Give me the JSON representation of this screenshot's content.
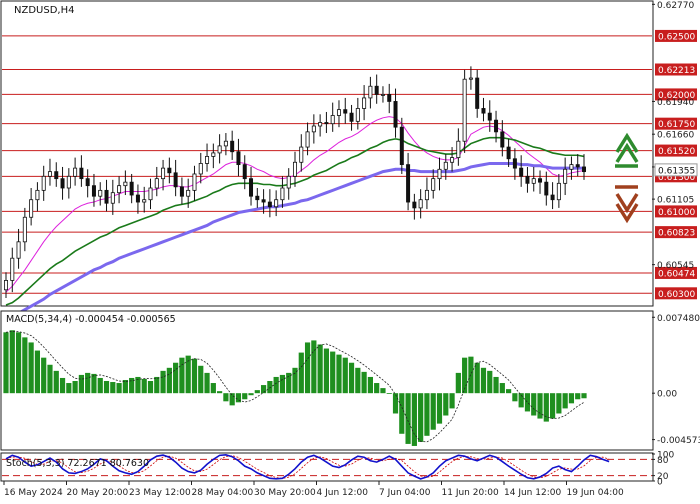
{
  "chart_data": [
    {
      "type": "candlestick",
      "title": "NZDUSD,H4",
      "ylim": [
        0.602,
        0.6279
      ],
      "price_tick_labels": [
        {
          "value": 0.6277,
          "label": "0.62770"
        },
        {
          "value": 0.6194,
          "label": "0.61940"
        },
        {
          "value": 0.6166,
          "label": "0.61660"
        },
        {
          "value": 0.6138,
          "label": "0.61380"
        },
        {
          "value": 0.61105,
          "label": "0.61105"
        },
        {
          "value": 0.60545,
          "label": "0.60545"
        }
      ],
      "levels": [
        {
          "value": 0.625,
          "label": "0.62500"
        },
        {
          "value": 0.62213,
          "label": "0.62213"
        },
        {
          "value": 0.62,
          "label": "0.62000"
        },
        {
          "value": 0.6175,
          "label": "0.61750"
        },
        {
          "value": 0.6152,
          "label": "0.61520"
        },
        {
          "value": 0.613,
          "label": "0.61300"
        },
        {
          "value": 0.61,
          "label": "0.61000"
        },
        {
          "value": 0.60823,
          "label": "0.60823"
        },
        {
          "value": 0.60474,
          "label": "0.60474"
        },
        {
          "value": 0.603,
          "label": "0.60300"
        }
      ],
      "current_price": {
        "value": 0.61355,
        "label": "0.61355"
      },
      "trend_signals": [
        "up-arrow",
        "down-arrow"
      ],
      "close_series": [
        0.6041,
        0.606,
        0.6074,
        0.6095,
        0.611,
        0.6118,
        0.613,
        0.6134,
        0.6128,
        0.612,
        0.613,
        0.6137,
        0.6128,
        0.6122,
        0.6113,
        0.6118,
        0.6107,
        0.6116,
        0.6122,
        0.6125,
        0.6114,
        0.6108,
        0.611,
        0.612,
        0.6128,
        0.6137,
        0.6133,
        0.6121,
        0.6113,
        0.6118,
        0.6132,
        0.6141,
        0.6147,
        0.615,
        0.6156,
        0.616,
        0.6151,
        0.614,
        0.6128,
        0.6113,
        0.611,
        0.6108,
        0.6104,
        0.611,
        0.612,
        0.613,
        0.6142,
        0.6155,
        0.6168,
        0.6173,
        0.6176,
        0.6175,
        0.6182,
        0.6187,
        0.6184,
        0.6177,
        0.6188,
        0.6197,
        0.6207,
        0.62,
        0.62,
        0.6194,
        0.6172,
        0.614,
        0.6108,
        0.6103,
        0.611,
        0.6118,
        0.6128,
        0.6136,
        0.6142,
        0.6146,
        0.616,
        0.6213,
        0.6214,
        0.6188,
        0.6184,
        0.6178,
        0.6168,
        0.6155,
        0.6145,
        0.6137,
        0.613,
        0.6124,
        0.6128,
        0.6125,
        0.6114,
        0.611,
        0.6124,
        0.6136,
        0.614,
        0.6138,
        0.6134
      ],
      "moving_averages": [
        {
          "color": "#dd22dd",
          "values": [
            0.6031,
            0.6036,
            0.6043,
            0.605,
            0.6058,
            0.6066,
            0.6074,
            0.6081,
            0.6087,
            0.6092,
            0.6097,
            0.6102,
            0.6105,
            0.6107,
            0.6108,
            0.611,
            0.6111,
            0.6113,
            0.6115,
            0.6117,
            0.6117,
            0.6117,
            0.6117,
            0.6118,
            0.6119,
            0.6121,
            0.6122,
            0.6122,
            0.6121,
            0.6121,
            0.6123,
            0.6126,
            0.6129,
            0.6132,
            0.6136,
            0.614,
            0.6142,
            0.6142,
            0.6141,
            0.6139,
            0.6136,
            0.6134,
            0.6131,
            0.6129,
            0.6128,
            0.6129,
            0.6131,
            0.6135,
            0.6139,
            0.6144,
            0.6148,
            0.6151,
            0.6155,
            0.6159,
            0.6162,
            0.6164,
            0.6167,
            0.6171,
            0.6175,
            0.6178,
            0.618,
            0.6181,
            0.618,
            0.6175,
            0.6167,
            0.616,
            0.6154,
            0.615,
            0.6147,
            0.6145,
            0.6144,
            0.6144,
            0.6146,
            0.6156,
            0.6166,
            0.6169,
            0.6172,
            0.6173,
            0.6172,
            0.6169,
            0.6165,
            0.616,
            0.6155,
            0.615,
            0.6146,
            0.6142,
            0.6137,
            0.6132,
            0.613,
            0.6131,
            0.6133,
            0.6134,
            0.6135
          ]
        },
        {
          "color": "#1a7a1a",
          "values": [
            0.602,
            0.6022,
            0.6026,
            0.6031,
            0.6036,
            0.6041,
            0.6046,
            0.6051,
            0.6055,
            0.6058,
            0.6062,
            0.6066,
            0.6069,
            0.6072,
            0.6075,
            0.6078,
            0.608,
            0.6083,
            0.6086,
            0.6088,
            0.609,
            0.6092,
            0.6094,
            0.6096,
            0.6098,
            0.6101,
            0.6103,
            0.6105,
            0.6106,
            0.6107,
            0.6109,
            0.6111,
            0.6113,
            0.6116,
            0.6118,
            0.6121,
            0.6123,
            0.6124,
            0.6124,
            0.6124,
            0.6124,
            0.6123,
            0.6123,
            0.6122,
            0.6122,
            0.6123,
            0.6124,
            0.6126,
            0.6128,
            0.6131,
            0.6133,
            0.6135,
            0.6138,
            0.6141,
            0.6143,
            0.6146,
            0.6148,
            0.6151,
            0.6154,
            0.6156,
            0.6159,
            0.6161,
            0.6162,
            0.6161,
            0.6158,
            0.6156,
            0.6154,
            0.6152,
            0.6151,
            0.615,
            0.6149,
            0.6149,
            0.615,
            0.6154,
            0.6158,
            0.616,
            0.6162,
            0.6163,
            0.6163,
            0.6163,
            0.6162,
            0.6161,
            0.6159,
            0.6157,
            0.6155,
            0.6154,
            0.6152,
            0.615,
            0.6149,
            0.6148,
            0.6148,
            0.6148,
            0.6147
          ]
        },
        {
          "color": "#7b68ee",
          "values": [
            0.6008,
            0.601,
            0.6013,
            0.6016,
            0.6019,
            0.6022,
            0.6025,
            0.6029,
            0.6032,
            0.6035,
            0.6038,
            0.6041,
            0.6044,
            0.6047,
            0.605,
            0.6052,
            0.6055,
            0.6057,
            0.606,
            0.6062,
            0.6064,
            0.6066,
            0.6068,
            0.607,
            0.6072,
            0.6074,
            0.6076,
            0.6078,
            0.608,
            0.6082,
            0.6084,
            0.6086,
            0.6088,
            0.6091,
            0.6093,
            0.6095,
            0.6097,
            0.6099,
            0.61,
            0.6101,
            0.6102,
            0.6103,
            0.6104,
            0.6104,
            0.6105,
            0.6106,
            0.6107,
            0.6109,
            0.611,
            0.6112,
            0.6114,
            0.6116,
            0.6118,
            0.612,
            0.6122,
            0.6124,
            0.6126,
            0.6128,
            0.613,
            0.6132,
            0.6134,
            0.6135,
            0.6136,
            0.6136,
            0.6135,
            0.6135,
            0.6134,
            0.6134,
            0.6134,
            0.6134,
            0.6134,
            0.6134,
            0.6135,
            0.6136,
            0.6138,
            0.6139,
            0.614,
            0.6141,
            0.6141,
            0.6141,
            0.6141,
            0.6141,
            0.614,
            0.614,
            0.6139,
            0.6139,
            0.6138,
            0.6137,
            0.6137,
            0.6137,
            0.6137,
            0.6137,
            0.6137
          ]
        }
      ]
    },
    {
      "type": "bar",
      "title": "MACD(5,34,4) -0.000454 -0.000565",
      "ylim": [
        -0.0055,
        0.008
      ],
      "tick_labels": [
        {
          "value": 0.00748,
          "label": "0.007480"
        },
        {
          "value": 0,
          "label": "0.00"
        },
        {
          "value": -0.004573,
          "label": "-0.004573"
        }
      ],
      "bar_color": "#1f8f1f",
      "signal_color": "#222222",
      "histogram": [
        0.006,
        0.0062,
        0.006,
        0.0055,
        0.005,
        0.0042,
        0.0035,
        0.0028,
        0.0022,
        0.0015,
        0.001,
        0.0012,
        0.0018,
        0.002,
        0.0019,
        0.0015,
        0.0012,
        0.0011,
        0.001,
        0.0013,
        0.0015,
        0.0016,
        0.0014,
        0.0012,
        0.0016,
        0.0022,
        0.0025,
        0.003,
        0.0035,
        0.0037,
        0.0034,
        0.0027,
        0.002,
        0.001,
        0.0002,
        -0.0008,
        -0.0012,
        -0.0009,
        -0.0006,
        -0.0002,
        0.0003,
        0.0008,
        0.0012,
        0.0016,
        0.0018,
        0.002,
        0.0025,
        0.004,
        0.005,
        0.0052,
        0.0048,
        0.0044,
        0.0041,
        0.0038,
        0.0035,
        0.003,
        0.0025,
        0.0021,
        0.0016,
        0.001,
        0.0005,
        0.0,
        -0.002,
        -0.004,
        -0.005,
        -0.0052,
        -0.0048,
        -0.0042,
        -0.0036,
        -0.003,
        -0.0022,
        -0.0015,
        0.002,
        0.0035,
        0.0036,
        0.003,
        0.0025,
        0.0022,
        0.0016,
        0.001,
        0.0004,
        -0.0008,
        -0.0014,
        -0.0018,
        -0.0022,
        -0.0025,
        -0.0028,
        -0.0025,
        -0.002,
        -0.0015,
        -0.001,
        -0.0006,
        -0.0005
      ]
    },
    {
      "type": "line",
      "title": "Stoch(5,3,3) 72.2671 80.7630",
      "ylim": [
        0,
        100
      ],
      "tick_labels": [
        {
          "value": 100,
          "label": "100"
        },
        {
          "value": 80,
          "label": "80"
        },
        {
          "value": 20,
          "label": "20"
        },
        {
          "value": 0,
          "label": "0"
        }
      ],
      "levels": [
        80,
        20
      ],
      "main_color": "#1111cc",
      "signal_color": "#cc0000",
      "k": [
        82,
        95,
        88,
        70,
        55,
        60,
        72,
        85,
        70,
        45,
        30,
        28,
        35,
        45,
        62,
        82,
        75,
        55,
        38,
        30,
        25,
        35,
        55,
        78,
        92,
        96,
        88,
        70,
        48,
        35,
        30,
        40,
        62,
        80,
        95,
        97,
        90,
        75,
        55,
        45,
        30,
        20,
        10,
        8,
        10,
        25,
        45,
        70,
        88,
        95,
        85,
        70,
        55,
        50,
        60,
        78,
        92,
        88,
        75,
        70,
        80,
        92,
        80,
        55,
        30,
        18,
        8,
        15,
        30,
        55,
        75,
        85,
        95,
        92,
        82,
        75,
        85,
        95,
        88,
        72,
        55,
        40,
        25,
        12,
        8,
        15,
        28,
        48,
        55,
        42,
        35,
        55,
        78,
        95,
        90,
        80,
        72
      ],
      "x_tick_labels": [
        "16 May 2024",
        "20 May 20:00",
        "23 May 12:00",
        "28 May 04:00",
        "30 May 20:00",
        "4 Jun 12:00",
        "7 Jun 04:00",
        "11 Jun 20:00",
        "14 Jun 12:00",
        "19 Jun 04:00"
      ]
    }
  ]
}
